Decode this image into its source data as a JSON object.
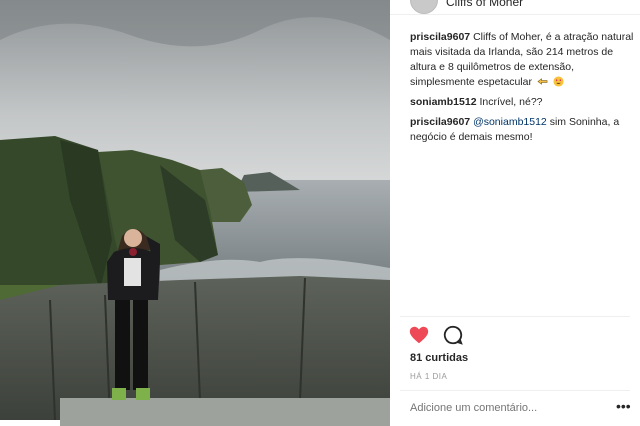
{
  "post": {
    "location": "Cliffs of Moher",
    "photo_alt": "Mulher em frente às falésias Cliffs of Moher"
  },
  "comments": [
    {
      "username": "priscila9607",
      "text": "Cliffs of Moher, é a atração natural mais visitada da Irlanda, são 214 metros de altura e 8 quilômetros de extensão, simplesmente espetacular",
      "emoji": [
        "hand-point-left-icon",
        "heart-eyes-emoji-icon"
      ]
    },
    {
      "username": "soniamb1512",
      "text": "Incrível, né??"
    },
    {
      "username": "priscila9607",
      "mention": "@soniamb1512",
      "text": "sim Soninha, a negócio é demais mesmo!"
    }
  ],
  "actions": {
    "like_icon": "heart-icon",
    "comment_icon": "speech-bubble-icon",
    "like_color": "#ed4956"
  },
  "likes": "81 curtidas",
  "timestamp": "HÁ 1 DIA",
  "comment_input": {
    "placeholder": "Adicione um comentário..."
  },
  "more_label": "•••"
}
